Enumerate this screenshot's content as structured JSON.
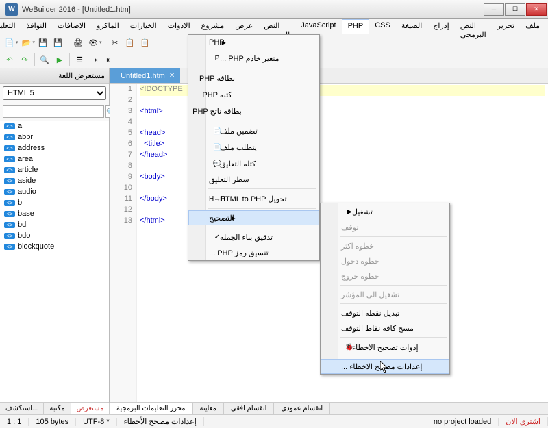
{
  "window": {
    "title": "WeBuilder 2016 - [Untitled1.htm]"
  },
  "menu": {
    "items": [
      "ملف",
      "تحرير",
      "النص البرمجي",
      "إدراج",
      "الصيغة",
      "CSS",
      "PHP",
      "JavaScript",
      "النص البرمجي",
      "عرض",
      "مشروع",
      "الادوات",
      "الخيارات",
      "الماكرو",
      "الاضافات",
      "النوافذ",
      "التعليمات"
    ]
  },
  "sidebar": {
    "header": "مستعرض اللغة",
    "doctype": "HTML 5",
    "tags": [
      "a",
      "abbr",
      "address",
      "area",
      "article",
      "aside",
      "audio",
      "b",
      "base",
      "bdi",
      "bdo",
      "blockquote"
    ],
    "tabs": [
      "استكشف...",
      "مكتبه",
      "مستعرض"
    ]
  },
  "editor": {
    "tab": "Untitled1.htm",
    "highlight_line": 1,
    "lines": [
      {
        "n": 1,
        "raw": "<!DOCTYPE"
      },
      {
        "n": 2,
        "raw": ""
      },
      {
        "n": 3,
        "raw": "<html>"
      },
      {
        "n": 4,
        "raw": ""
      },
      {
        "n": 5,
        "raw": "<head>"
      },
      {
        "n": 6,
        "raw": "  <title>"
      },
      {
        "n": 7,
        "raw": "</head>"
      },
      {
        "n": 8,
        "raw": ""
      },
      {
        "n": 9,
        "raw": "<body>"
      },
      {
        "n": 10,
        "raw": ""
      },
      {
        "n": 11,
        "raw": "</body>"
      },
      {
        "n": 12,
        "raw": ""
      },
      {
        "n": 13,
        "raw": "</html>"
      }
    ],
    "bottom_tabs": [
      "محرر التعليمات البرمجية",
      "معاينه",
      "انقسام افقي",
      "انقسام عمودي"
    ]
  },
  "php_menu": {
    "items": [
      {
        "label": "PHP",
        "arrow": true,
        "icon": ""
      },
      {
        "label": "... PHP متغير خادم",
        "icon": "P"
      },
      {
        "sep": true
      },
      {
        "label": "PHP بطاقة",
        "icon": "<?"
      },
      {
        "label": "PHP كتبه",
        "icon": "<?"
      },
      {
        "label": "PHP بطاقة ناتج",
        "icon": "<?="
      },
      {
        "sep": true
      },
      {
        "label": "تضمين ملف",
        "icon": "📄"
      },
      {
        "label": "يتطلب ملف",
        "icon": "📄"
      },
      {
        "label": "كتله التعليق",
        "icon": "💬"
      },
      {
        "label": "سطر التعليق",
        "icon": ""
      },
      {
        "sep": true
      },
      {
        "label": "HTML to PHP تحويل",
        "icon": "H↔P"
      },
      {
        "sep": true
      },
      {
        "label": "التصحيح",
        "arrow": true,
        "highlight": true,
        "icon": ""
      },
      {
        "sep": true
      },
      {
        "label": "تدقيق بناء الجملة",
        "icon": "✓"
      },
      {
        "label": "... PHP تنسيق رمز",
        "icon": ""
      }
    ]
  },
  "debug_menu": {
    "items": [
      {
        "label": "تشغيل",
        "icon": "▶"
      },
      {
        "label": "توقف",
        "disabled": true,
        "icon": ""
      },
      {
        "sep": true
      },
      {
        "label": "خطوه اكثر",
        "disabled": true,
        "icon": ""
      },
      {
        "label": "خطوة دخول",
        "disabled": true,
        "icon": ""
      },
      {
        "label": "خطوة خروج",
        "disabled": true,
        "icon": ""
      },
      {
        "sep": true
      },
      {
        "label": "تشغيل الى المؤشر",
        "disabled": true,
        "icon": ""
      },
      {
        "sep": true
      },
      {
        "label": "تبديل نقطه التوقف",
        "icon": ""
      },
      {
        "label": "مسح كافة نقاط التوقف",
        "icon": ""
      },
      {
        "sep": true
      },
      {
        "label": "إدوات تصحيح الاخطاء",
        "icon": "🐞"
      },
      {
        "sep": true
      },
      {
        "label": "... إعدادات مصحح الاخطاء",
        "highlight": true,
        "icon": ""
      }
    ]
  },
  "status": {
    "pos": "1 : 1",
    "size": "105 bytes",
    "enc": "UTF-8 *",
    "msg": "إعدادات مصحح الأخطاء",
    "project": "no project loaded",
    "buy": "اشتري الان"
  }
}
